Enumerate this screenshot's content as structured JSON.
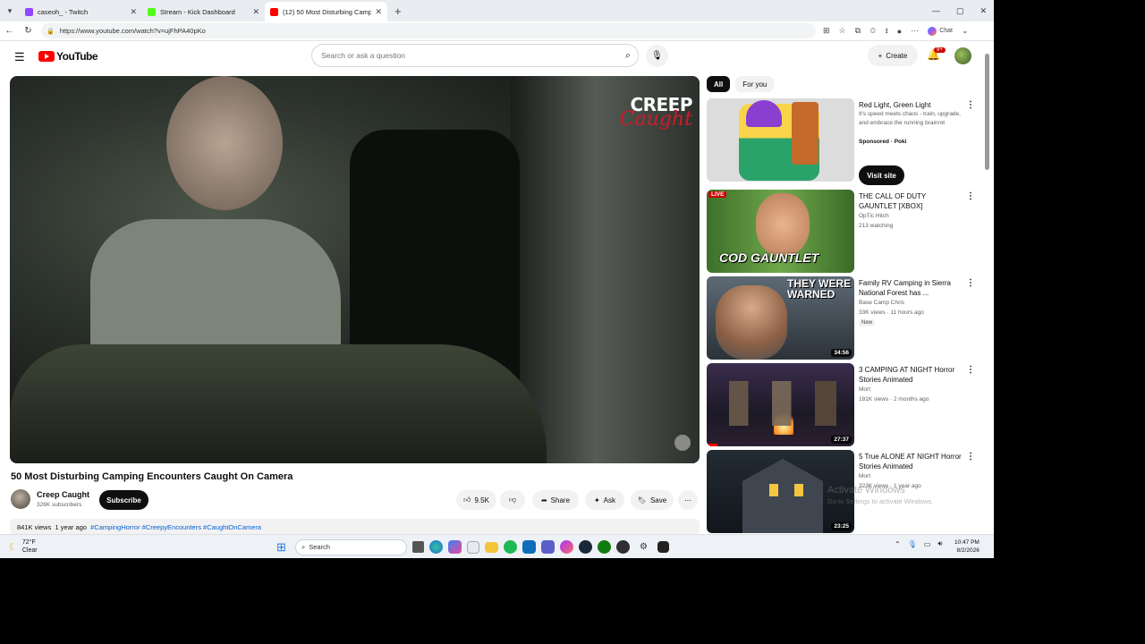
{
  "browser": {
    "tabs": [
      {
        "title": "caseoh_ - Twitch",
        "favicon_color": "#9146ff"
      },
      {
        "title": "Stream - Kick Dashboard",
        "favicon_color": "#53fc18"
      },
      {
        "title": "(12) 50 Most Disturbing Camp",
        "favicon_color": "#ff0000"
      }
    ],
    "url": "https://www.youtube.com/watch?v=ujFhPA40pKo",
    "chat_label": "Chat"
  },
  "youtube": {
    "logo_text": "YouTube",
    "search_placeholder": "Search or ask a question",
    "create_label": "Create",
    "notif_count": "9+"
  },
  "video": {
    "title": "50 Most Disturbing Camping Encounters Caught On Camera",
    "brand_line1": "CREEP",
    "brand_line2": "Caught",
    "channel": "Creep Caught",
    "subscribers": "326K subscribers",
    "subscribe_label": "Subscribe",
    "likes": "9.5K",
    "share_label": "Share",
    "ask_label": "Ask",
    "save_label": "Save",
    "views": "841K views",
    "age": "1 year ago",
    "tags": "#CampingHorror #CreepyEncounters #CaughtOnCamera"
  },
  "sidebar": {
    "chips": [
      "All",
      "For you"
    ],
    "items": [
      {
        "title": "Red Light, Green Light",
        "line1": "It's speed meets chaos - train, upgrade, and embrace the running brainrot",
        "line2": "Sponsored · Poki",
        "action": "Visit site"
      },
      {
        "title": "THE CALL OF DUTY GAUNTLET [XBOX]",
        "line1": "OpTic Hitch",
        "line2": "213 watching",
        "badge": "LIVE",
        "thumb_text": "COD GAUNTLET"
      },
      {
        "title": "Family RV Camping in Sierra National Forest has ...",
        "line1": "Base Camp Chris",
        "line2": "33K views · 11 hours ago",
        "badge": "New",
        "duration": "34:56",
        "thumb_text": "THEY WERE WARNED"
      },
      {
        "title": "3 CAMPING AT NIGHT Horror Stories Animated",
        "line1": "Mort",
        "line2": "181K views · 2 months ago",
        "duration": "27:37"
      },
      {
        "title": "5 True ALONE AT NIGHT Horror Stories Animated",
        "line1": "Mort",
        "line2": "323K views · 1 year ago",
        "duration": "23:25"
      }
    ]
  },
  "overlay": {
    "activate_title": "Activate Windows",
    "activate_sub": "Go to Settings to activate Windows."
  },
  "taskbar": {
    "temp": "72°F",
    "condition": "Clear",
    "search_label": "Search",
    "time": "10:47 PM",
    "date": "8/2/2026"
  }
}
